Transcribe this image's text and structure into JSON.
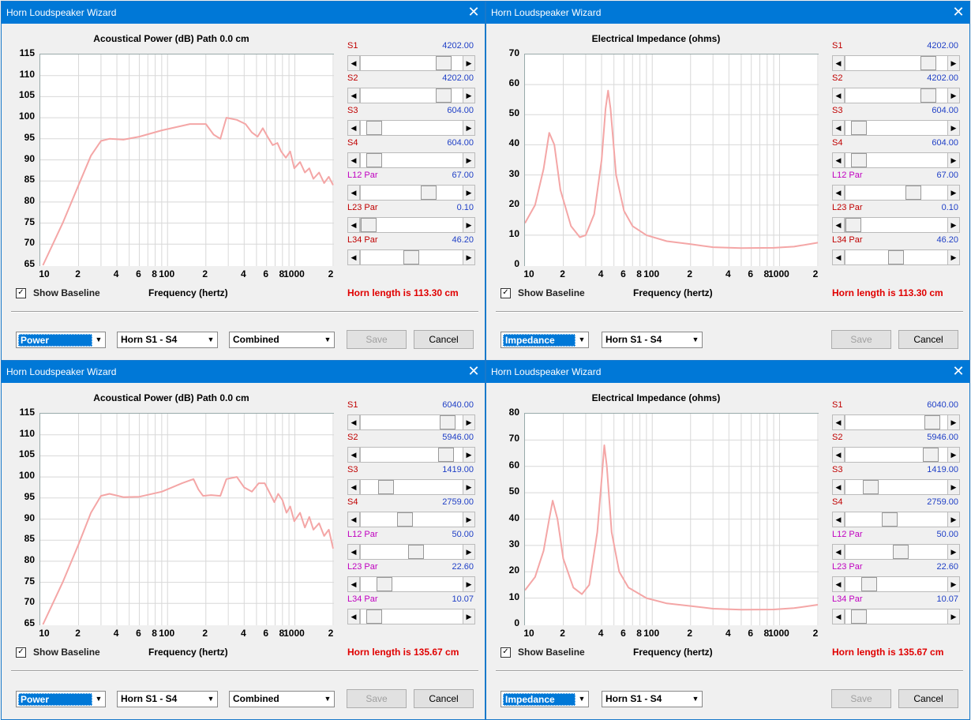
{
  "windows": [
    {
      "title": "Horn Loudspeaker Wizard",
      "chart_title": "Acoustical Power (dB)   Path 0.0 cm",
      "checkbox_label": "Show Baseline",
      "checkbox_checked": true,
      "xlabel": "Frequency (hertz)",
      "horn_length": "Horn length is 113.30 cm",
      "combo1": "Power",
      "combo2": "Horn S1 - S4",
      "combo3": "Combined",
      "save_label": "Save",
      "cancel_label": "Cancel",
      "sliders": [
        {
          "label": "S1",
          "value": "4202.00",
          "color": "#c00000",
          "pos": 0.78
        },
        {
          "label": "S2",
          "value": "4202.00",
          "color": "#c00000",
          "pos": 0.78
        },
        {
          "label": "S3",
          "value": "604.00",
          "color": "#c00000",
          "pos": 0.06
        },
        {
          "label": "S4",
          "value": "604.00",
          "color": "#c00000",
          "pos": 0.06
        },
        {
          "label": "L12  Par",
          "value": "67.00",
          "color": "#c000c0",
          "pos": 0.62
        },
        {
          "label": "L23  Par",
          "value": "0.10",
          "color": "#c00000",
          "pos": 0.0
        },
        {
          "label": "L34  Par",
          "value": "46.20",
          "color": "#c00000",
          "pos": 0.44
        }
      ],
      "chart_data": {
        "type": "line",
        "title": "Acoustical Power (dB)   Path 0.0 cm",
        "xlabel": "Frequency (hertz)",
        "x_log": true,
        "xlim": [
          10,
          2000
        ],
        "ylim": [
          65,
          115
        ],
        "yticks": [
          "115",
          "110",
          "105",
          "100",
          "95",
          "90",
          "85",
          "80",
          "75",
          "70",
          "65"
        ],
        "xticks": [
          "10",
          "2",
          "4",
          "6",
          "8",
          "100",
          "2",
          "4",
          "6",
          "8",
          "1000",
          "2"
        ],
        "series": [
          {
            "color": "#f4a6a6",
            "points": [
              [
                10.5,
                65
              ],
              [
                15,
                75
              ],
              [
                20,
                84
              ],
              [
                25,
                91
              ],
              [
                30,
                94.5
              ],
              [
                35,
                95
              ],
              [
                45,
                94.8
              ],
              [
                60,
                95.5
              ],
              [
                90,
                97
              ],
              [
                150,
                98.5
              ],
              [
                200,
                98.5
              ],
              [
                230,
                96
              ],
              [
                260,
                95
              ],
              [
                290,
                100
              ],
              [
                350,
                99.5
              ],
              [
                410,
                98.5
              ],
              [
                460,
                96.5
              ],
              [
                510,
                95.5
              ],
              [
                560,
                97.5
              ],
              [
                610,
                95.5
              ],
              [
                670,
                93.5
              ],
              [
                730,
                94
              ],
              [
                780,
                92
              ],
              [
                850,
                90.5
              ],
              [
                920,
                92
              ],
              [
                990,
                88
              ],
              [
                1100,
                89.5
              ],
              [
                1200,
                87
              ],
              [
                1300,
                88
              ],
              [
                1400,
                85.5
              ],
              [
                1550,
                87
              ],
              [
                1700,
                84.5
              ],
              [
                1850,
                86
              ],
              [
                2000,
                84
              ]
            ]
          }
        ]
      }
    },
    {
      "title": "Horn Loudspeaker Wizard",
      "chart_title": "Electrical Impedance (ohms)",
      "checkbox_label": "Show Baseline",
      "checkbox_checked": true,
      "xlabel": "Frequency (hertz)",
      "horn_length": "Horn length is 113.30 cm",
      "combo1": "Impedance",
      "combo2": "Horn S1 - S4",
      "save_label": "Save",
      "cancel_label": "Cancel",
      "sliders": [
        {
          "label": "S1",
          "value": "4202.00",
          "color": "#c00000",
          "pos": 0.78
        },
        {
          "label": "S2",
          "value": "4202.00",
          "color": "#c00000",
          "pos": 0.78
        },
        {
          "label": "S3",
          "value": "604.00",
          "color": "#c00000",
          "pos": 0.06
        },
        {
          "label": "S4",
          "value": "604.00",
          "color": "#c00000",
          "pos": 0.06
        },
        {
          "label": "L12  Par",
          "value": "67.00",
          "color": "#c000c0",
          "pos": 0.62
        },
        {
          "label": "L23  Par",
          "value": "0.10",
          "color": "#c00000",
          "pos": 0.0
        },
        {
          "label": "L34  Par",
          "value": "46.20",
          "color": "#c00000",
          "pos": 0.44
        }
      ],
      "chart_data": {
        "type": "line",
        "title": "Electrical Impedance (ohms)",
        "xlabel": "Frequency (hertz)",
        "x_log": true,
        "xlim": [
          10,
          2000
        ],
        "ylim": [
          0,
          70
        ],
        "yticks": [
          "70",
          "60",
          "50",
          "40",
          "30",
          "20",
          "10",
          "0"
        ],
        "xticks": [
          "10",
          "2",
          "4",
          "6",
          "8",
          "100",
          "2",
          "4",
          "6",
          "8",
          "1000",
          "2"
        ],
        "series": [
          {
            "color": "#f4a6a6",
            "points": [
              [
                10,
                14
              ],
              [
                12,
                20
              ],
              [
                14,
                32
              ],
              [
                15.5,
                44
              ],
              [
                17,
                40
              ],
              [
                19,
                25
              ],
              [
                23,
                13
              ],
              [
                27,
                9.3
              ],
              [
                30,
                10
              ],
              [
                35,
                17
              ],
              [
                40,
                35
              ],
              [
                43,
                52
              ],
              [
                45,
                58
              ],
              [
                47,
                52
              ],
              [
                52,
                30
              ],
              [
                60,
                18
              ],
              [
                70,
                13
              ],
              [
                90,
                10
              ],
              [
                130,
                8
              ],
              [
                200,
                7
              ],
              [
                300,
                6
              ],
              [
                500,
                5.7
              ],
              [
                900,
                5.8
              ],
              [
                1300,
                6.2
              ],
              [
                2000,
                7.5
              ]
            ]
          }
        ]
      }
    },
    {
      "title": "Horn Loudspeaker Wizard",
      "chart_title": "Acoustical Power (dB)   Path 0.0 cm",
      "checkbox_label": "Show Baseline",
      "checkbox_checked": true,
      "xlabel": "Frequency (hertz)",
      "horn_length": "Horn length is 135.67 cm",
      "combo1": "Power",
      "combo2": "Horn S1 - S4",
      "combo3": "Combined",
      "save_label": "Save",
      "cancel_label": "Cancel",
      "sliders": [
        {
          "label": "S1",
          "value": "6040.00",
          "color": "#c00000",
          "pos": 0.82
        },
        {
          "label": "S2",
          "value": "5946.00",
          "color": "#c00000",
          "pos": 0.8
        },
        {
          "label": "S3",
          "value": "1419.00",
          "color": "#c00000",
          "pos": 0.18
        },
        {
          "label": "S4",
          "value": "2759.00",
          "color": "#c00000",
          "pos": 0.38
        },
        {
          "label": "L12  Par",
          "value": "50.00",
          "color": "#c000c0",
          "pos": 0.49
        },
        {
          "label": "L23  Par",
          "value": "22.60",
          "color": "#c000c0",
          "pos": 0.16
        },
        {
          "label": "L34  Par",
          "value": "10.07",
          "color": "#c000c0",
          "pos": 0.06
        }
      ],
      "chart_data": {
        "type": "line",
        "title": "Acoustical Power (dB)   Path 0.0 cm",
        "xlabel": "Frequency (hertz)",
        "x_log": true,
        "xlim": [
          10,
          2000
        ],
        "ylim": [
          65,
          115
        ],
        "yticks": [
          "115",
          "110",
          "105",
          "100",
          "95",
          "90",
          "85",
          "80",
          "75",
          "70",
          "65"
        ],
        "xticks": [
          "10",
          "2",
          "4",
          "6",
          "8",
          "100",
          "2",
          "4",
          "6",
          "8",
          "1000",
          "2"
        ],
        "series": [
          {
            "color": "#f4a6a6",
            "points": [
              [
                10.5,
                65
              ],
              [
                15,
                75
              ],
              [
                20,
                84
              ],
              [
                25,
                91.5
              ],
              [
                30,
                95.5
              ],
              [
                35,
                96
              ],
              [
                45,
                95.2
              ],
              [
                60,
                95.3
              ],
              [
                90,
                96.5
              ],
              [
                130,
                98.5
              ],
              [
                160,
                99.5
              ],
              [
                175,
                97
              ],
              [
                190,
                95.5
              ],
              [
                220,
                95.7
              ],
              [
                260,
                95.5
              ],
              [
                290,
                99.5
              ],
              [
                350,
                100
              ],
              [
                400,
                97.5
              ],
              [
                460,
                96.5
              ],
              [
                520,
                98.5
              ],
              [
                580,
                98.5
              ],
              [
                640,
                96
              ],
              [
                690,
                94
              ],
              [
                740,
                96
              ],
              [
                800,
                94.5
              ],
              [
                860,
                91.5
              ],
              [
                920,
                93
              ],
              [
                990,
                89.5
              ],
              [
                1100,
                91.5
              ],
              [
                1200,
                88
              ],
              [
                1300,
                90.5
              ],
              [
                1400,
                87.5
              ],
              [
                1550,
                89
              ],
              [
                1700,
                86
              ],
              [
                1850,
                87.5
              ],
              [
                2000,
                83
              ]
            ]
          }
        ]
      }
    },
    {
      "title": "Horn Loudspeaker Wizard",
      "chart_title": "Electrical Impedance (ohms)",
      "checkbox_label": "Show Baseline",
      "checkbox_checked": true,
      "xlabel": "Frequency (hertz)",
      "horn_length": "Horn length is 135.67 cm",
      "combo1": "Impedance",
      "combo2": "Horn S1 - S4",
      "save_label": "Save",
      "cancel_label": "Cancel",
      "sliders": [
        {
          "label": "S1",
          "value": "6040.00",
          "color": "#c00000",
          "pos": 0.82
        },
        {
          "label": "S2",
          "value": "5946.00",
          "color": "#c00000",
          "pos": 0.8
        },
        {
          "label": "S3",
          "value": "1419.00",
          "color": "#c00000",
          "pos": 0.18
        },
        {
          "label": "S4",
          "value": "2759.00",
          "color": "#c00000",
          "pos": 0.38
        },
        {
          "label": "L12  Par",
          "value": "50.00",
          "color": "#c000c0",
          "pos": 0.49
        },
        {
          "label": "L23  Par",
          "value": "22.60",
          "color": "#c000c0",
          "pos": 0.16
        },
        {
          "label": "L34  Par",
          "value": "10.07",
          "color": "#c000c0",
          "pos": 0.06
        }
      ],
      "chart_data": {
        "type": "line",
        "title": "Electrical Impedance (ohms)",
        "xlabel": "Frequency (hertz)",
        "x_log": true,
        "xlim": [
          10,
          2000
        ],
        "ylim": [
          0,
          80
        ],
        "yticks": [
          "80",
          "70",
          "60",
          "50",
          "40",
          "30",
          "20",
          "10",
          "0"
        ],
        "xticks": [
          "10",
          "2",
          "4",
          "6",
          "8",
          "100",
          "2",
          "4",
          "6",
          "8",
          "1000",
          "2"
        ],
        "series": [
          {
            "color": "#f4a6a6",
            "points": [
              [
                10,
                13
              ],
              [
                12,
                18
              ],
              [
                14,
                28
              ],
              [
                15.5,
                40
              ],
              [
                16.5,
                47
              ],
              [
                18,
                40
              ],
              [
                20,
                25
              ],
              [
                24,
                14
              ],
              [
                28,
                11.5
              ],
              [
                32,
                15
              ],
              [
                37,
                35
              ],
              [
                40,
                55
              ],
              [
                42,
                68
              ],
              [
                44,
                60
              ],
              [
                48,
                35
              ],
              [
                55,
                20
              ],
              [
                65,
                14
              ],
              [
                90,
                10
              ],
              [
                130,
                8
              ],
              [
                200,
                7
              ],
              [
                300,
                6
              ],
              [
                500,
                5.6
              ],
              [
                900,
                5.7
              ],
              [
                1300,
                6.2
              ],
              [
                2000,
                7.5
              ]
            ]
          }
        ]
      }
    }
  ]
}
